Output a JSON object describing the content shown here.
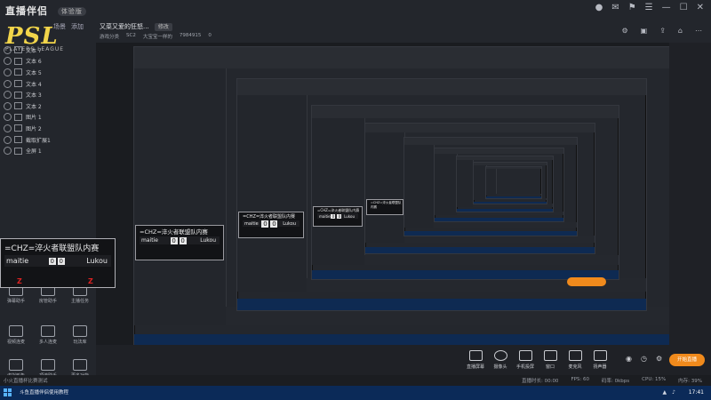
{
  "app": {
    "name": "直播伴侣",
    "version_badge": "体验版",
    "window_controls": [
      "avatar-icon",
      "mail-icon",
      "tshirt-icon",
      "menu-icon",
      "minimize-icon",
      "maximize-icon",
      "close-icon"
    ]
  },
  "left_panel": {
    "brand_text": "PSL",
    "brand_sub": "PLAYERS LEAGUE",
    "tabs": [
      "场景",
      "添加"
    ],
    "sources": [
      "文本 7",
      "文本 6",
      "文本 5",
      "文本 4",
      "文本 3",
      "文本 2",
      "图片 1",
      "图片 2",
      "截取扩展1",
      "全屏 1"
    ],
    "tools": [
      {
        "label": "弹幕助手"
      },
      {
        "label": "房管助手"
      },
      {
        "label": "主播任务"
      },
      {
        "label": "视频连麦"
      },
      {
        "label": "多人连麦"
      },
      {
        "label": "玩法库"
      },
      {
        "label": "虚拟形象"
      },
      {
        "label": "顶流助手"
      },
      {
        "label": "更多功能"
      }
    ]
  },
  "header": {
    "stream_title": "又菜又爱的狂怒...",
    "edit_label": "修改",
    "meta": [
      "游戏分类",
      "SC2",
      "大宝宝一样的",
      "7984915",
      "0"
    ],
    "icons": [
      "settings-icon",
      "gift-icon",
      "share-icon",
      "home-icon",
      "more-icon"
    ]
  },
  "scoreboard": {
    "title": "=CHZ=淬火者联盟队内赛",
    "player1": "maitie",
    "score1": "0",
    "score2": "0",
    "player2": "Lukou",
    "race1": "Z",
    "race2": "Z"
  },
  "bottom_tools": [
    {
      "label": "直播屏幕"
    },
    {
      "label": "摄像头"
    },
    {
      "label": "手机投屏"
    },
    {
      "label": "窗口"
    },
    {
      "label": "麦克风"
    },
    {
      "label": "扬声器"
    }
  ],
  "start_button": "开始直播",
  "statusbar": {
    "left": "小火直播杯比赛测试",
    "right": [
      "直播时长: 00:00",
      "FPS: 60",
      "码率: 0kbps",
      "CPU: 15%",
      "内存: 39%"
    ]
  },
  "taskbar": {
    "app_label": "斗鱼直播伴侣使用教程",
    "clock": "17:41"
  }
}
